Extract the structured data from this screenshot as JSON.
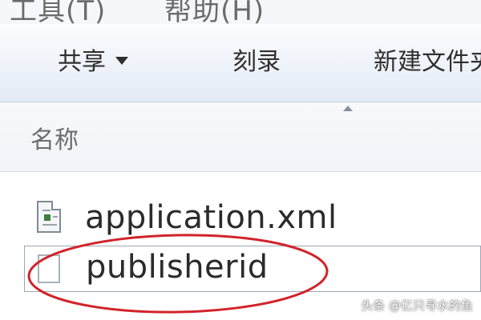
{
  "menubar": {
    "items": [
      {
        "label": "工具(T)"
      },
      {
        "label": "帮助(H)"
      }
    ]
  },
  "toolbar": {
    "share_label": "共享",
    "burn_label": "刻录",
    "new_folder_label": "新建文件夹"
  },
  "columns": {
    "name_header": "名称"
  },
  "files": [
    {
      "name": "application.xml",
      "icon": "xml-file-icon"
    },
    {
      "name": "publisherid",
      "icon": "blank-file-icon"
    }
  ],
  "annotation": {
    "color": "#d2232a"
  },
  "watermark": "头条 @亿只寻水的鱼"
}
